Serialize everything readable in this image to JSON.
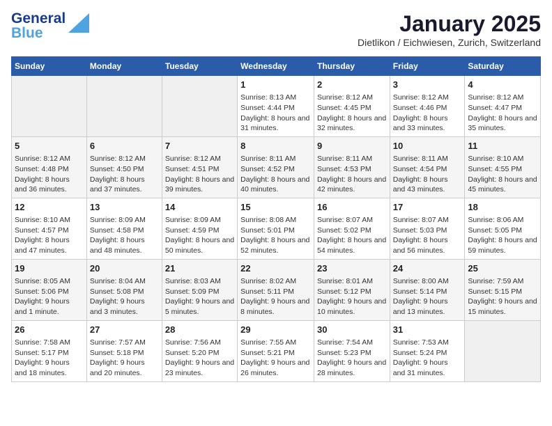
{
  "header": {
    "logo_line1": "General",
    "logo_line2": "Blue",
    "month": "January 2025",
    "location": "Dietlikon / Eichwiesen, Zurich, Switzerland"
  },
  "days_of_week": [
    "Sunday",
    "Monday",
    "Tuesday",
    "Wednesday",
    "Thursday",
    "Friday",
    "Saturday"
  ],
  "weeks": [
    [
      {
        "day": "",
        "sunrise": "",
        "sunset": "",
        "daylight": "",
        "empty": true
      },
      {
        "day": "",
        "sunrise": "",
        "sunset": "",
        "daylight": "",
        "empty": true
      },
      {
        "day": "",
        "sunrise": "",
        "sunset": "",
        "daylight": "",
        "empty": true
      },
      {
        "day": "1",
        "sunrise": "8:13 AM",
        "sunset": "4:44 PM",
        "daylight": "8 hours and 31 minutes."
      },
      {
        "day": "2",
        "sunrise": "8:12 AM",
        "sunset": "4:45 PM",
        "daylight": "8 hours and 32 minutes."
      },
      {
        "day": "3",
        "sunrise": "8:12 AM",
        "sunset": "4:46 PM",
        "daylight": "8 hours and 33 minutes."
      },
      {
        "day": "4",
        "sunrise": "8:12 AM",
        "sunset": "4:47 PM",
        "daylight": "8 hours and 35 minutes."
      }
    ],
    [
      {
        "day": "5",
        "sunrise": "8:12 AM",
        "sunset": "4:48 PM",
        "daylight": "8 hours and 36 minutes."
      },
      {
        "day": "6",
        "sunrise": "8:12 AM",
        "sunset": "4:50 PM",
        "daylight": "8 hours and 37 minutes."
      },
      {
        "day": "7",
        "sunrise": "8:12 AM",
        "sunset": "4:51 PM",
        "daylight": "8 hours and 39 minutes."
      },
      {
        "day": "8",
        "sunrise": "8:11 AM",
        "sunset": "4:52 PM",
        "daylight": "8 hours and 40 minutes."
      },
      {
        "day": "9",
        "sunrise": "8:11 AM",
        "sunset": "4:53 PM",
        "daylight": "8 hours and 42 minutes."
      },
      {
        "day": "10",
        "sunrise": "8:11 AM",
        "sunset": "4:54 PM",
        "daylight": "8 hours and 43 minutes."
      },
      {
        "day": "11",
        "sunrise": "8:10 AM",
        "sunset": "4:55 PM",
        "daylight": "8 hours and 45 minutes."
      }
    ],
    [
      {
        "day": "12",
        "sunrise": "8:10 AM",
        "sunset": "4:57 PM",
        "daylight": "8 hours and 47 minutes."
      },
      {
        "day": "13",
        "sunrise": "8:09 AM",
        "sunset": "4:58 PM",
        "daylight": "8 hours and 48 minutes."
      },
      {
        "day": "14",
        "sunrise": "8:09 AM",
        "sunset": "4:59 PM",
        "daylight": "8 hours and 50 minutes."
      },
      {
        "day": "15",
        "sunrise": "8:08 AM",
        "sunset": "5:01 PM",
        "daylight": "8 hours and 52 minutes."
      },
      {
        "day": "16",
        "sunrise": "8:07 AM",
        "sunset": "5:02 PM",
        "daylight": "8 hours and 54 minutes."
      },
      {
        "day": "17",
        "sunrise": "8:07 AM",
        "sunset": "5:03 PM",
        "daylight": "8 hours and 56 minutes."
      },
      {
        "day": "18",
        "sunrise": "8:06 AM",
        "sunset": "5:05 PM",
        "daylight": "8 hours and 59 minutes."
      }
    ],
    [
      {
        "day": "19",
        "sunrise": "8:05 AM",
        "sunset": "5:06 PM",
        "daylight": "9 hours and 1 minute."
      },
      {
        "day": "20",
        "sunrise": "8:04 AM",
        "sunset": "5:08 PM",
        "daylight": "9 hours and 3 minutes."
      },
      {
        "day": "21",
        "sunrise": "8:03 AM",
        "sunset": "5:09 PM",
        "daylight": "9 hours and 5 minutes."
      },
      {
        "day": "22",
        "sunrise": "8:02 AM",
        "sunset": "5:11 PM",
        "daylight": "9 hours and 8 minutes."
      },
      {
        "day": "23",
        "sunrise": "8:01 AM",
        "sunset": "5:12 PM",
        "daylight": "9 hours and 10 minutes."
      },
      {
        "day": "24",
        "sunrise": "8:00 AM",
        "sunset": "5:14 PM",
        "daylight": "9 hours and 13 minutes."
      },
      {
        "day": "25",
        "sunrise": "7:59 AM",
        "sunset": "5:15 PM",
        "daylight": "9 hours and 15 minutes."
      }
    ],
    [
      {
        "day": "26",
        "sunrise": "7:58 AM",
        "sunset": "5:17 PM",
        "daylight": "9 hours and 18 minutes."
      },
      {
        "day": "27",
        "sunrise": "7:57 AM",
        "sunset": "5:18 PM",
        "daylight": "9 hours and 20 minutes."
      },
      {
        "day": "28",
        "sunrise": "7:56 AM",
        "sunset": "5:20 PM",
        "daylight": "9 hours and 23 minutes."
      },
      {
        "day": "29",
        "sunrise": "7:55 AM",
        "sunset": "5:21 PM",
        "daylight": "9 hours and 26 minutes."
      },
      {
        "day": "30",
        "sunrise": "7:54 AM",
        "sunset": "5:23 PM",
        "daylight": "9 hours and 28 minutes."
      },
      {
        "day": "31",
        "sunrise": "7:53 AM",
        "sunset": "5:24 PM",
        "daylight": "9 hours and 31 minutes."
      },
      {
        "day": "",
        "sunrise": "",
        "sunset": "",
        "daylight": "",
        "empty": true
      }
    ]
  ],
  "labels": {
    "sunrise_prefix": "Sunrise: ",
    "sunset_prefix": "Sunset: ",
    "daylight_prefix": "Daylight: "
  }
}
